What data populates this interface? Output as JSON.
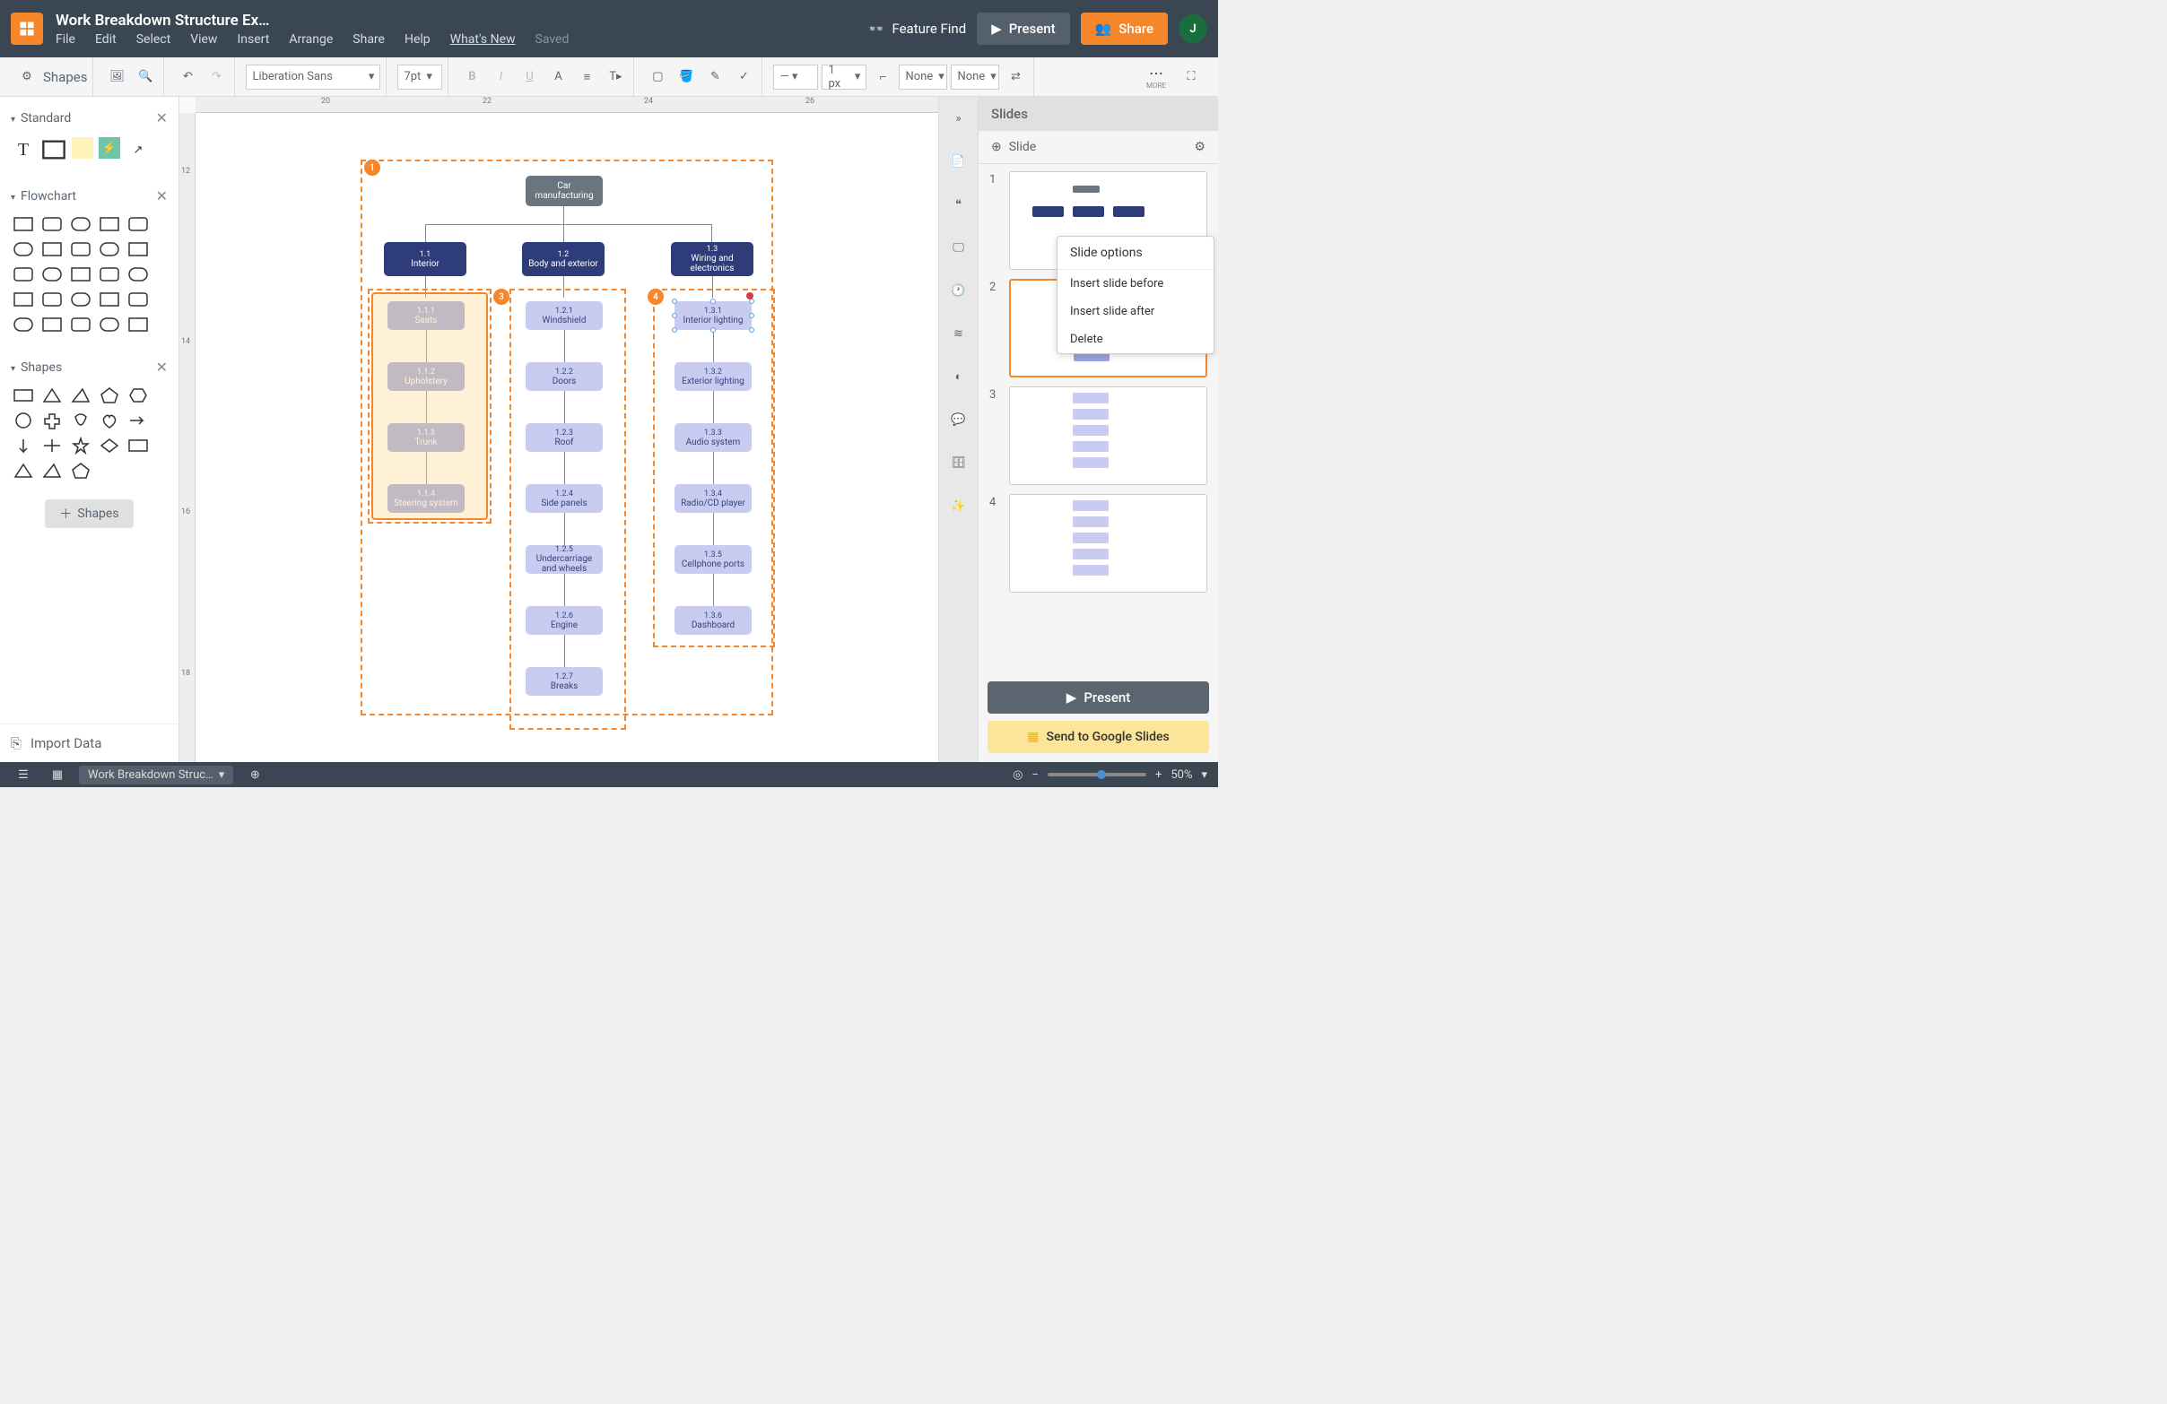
{
  "header": {
    "title": "Work Breakdown Structure Ex…",
    "menu": [
      "File",
      "Edit",
      "Select",
      "View",
      "Insert",
      "Arrange",
      "Share",
      "Help"
    ],
    "whats_new": "What's New",
    "saved": "Saved",
    "feature_find": "Feature Find",
    "present": "Present",
    "share": "Share",
    "avatar_letter": "J"
  },
  "toolbar": {
    "shapes_label": "Shapes",
    "font": "Liberation Sans",
    "font_size": "7pt",
    "line_width": "1 px",
    "line_start": "None",
    "line_end": "None",
    "more": "MORE"
  },
  "left": {
    "section_standard": "Standard",
    "section_flowchart": "Flowchart",
    "section_shapes": "Shapes",
    "shapes_btn": "Shapes",
    "import": "Import Data"
  },
  "diagram": {
    "root": {
      "label": "Car manufacturing"
    },
    "l1": [
      {
        "num": "1.1",
        "label": "Interior"
      },
      {
        "num": "1.2",
        "label": "Body and exterior"
      },
      {
        "num": "1.3",
        "label": "Wiring and electronics"
      }
    ],
    "col1": [
      {
        "num": "1.1.1",
        "label": "Seats"
      },
      {
        "num": "1.1.2",
        "label": "Upholstery"
      },
      {
        "num": "1.1.3",
        "label": "Trunk"
      },
      {
        "num": "1.1.4",
        "label": "Steering system"
      }
    ],
    "col2": [
      {
        "num": "1.2.1",
        "label": "Windshield"
      },
      {
        "num": "1.2.2",
        "label": "Doors"
      },
      {
        "num": "1.2.3",
        "label": "Roof"
      },
      {
        "num": "1.2.4",
        "label": "Side panels"
      },
      {
        "num": "1.2.5",
        "label": "Undercarriage and wheels"
      },
      {
        "num": "1.2.6",
        "label": "Engine"
      },
      {
        "num": "1.2.7",
        "label": "Breaks"
      }
    ],
    "col3": [
      {
        "num": "1.3.1",
        "label": "Interior lighting"
      },
      {
        "num": "1.3.2",
        "label": "Exterior lighting"
      },
      {
        "num": "1.3.3",
        "label": "Audio system"
      },
      {
        "num": "1.3.4",
        "label": "Radio/CD player"
      },
      {
        "num": "1.3.5",
        "label": "Cellphone ports"
      },
      {
        "num": "1.3.6",
        "label": "Dashboard"
      }
    ],
    "badges": [
      "1",
      "3",
      "4"
    ],
    "ruler_h": [
      "20",
      "22",
      "24",
      "26"
    ],
    "ruler_v": [
      "12",
      "14",
      "16",
      "18"
    ]
  },
  "slides": {
    "header": "Slides",
    "add": "Slide",
    "items": [
      "1",
      "2",
      "3",
      "4"
    ],
    "context": {
      "title": "Slide options",
      "items": [
        "Insert slide before",
        "Insert slide after",
        "Delete"
      ]
    },
    "present": "Present",
    "google": "Send to Google Slides"
  },
  "status": {
    "doc": "Work Breakdown Struc…",
    "zoom": "50%"
  }
}
